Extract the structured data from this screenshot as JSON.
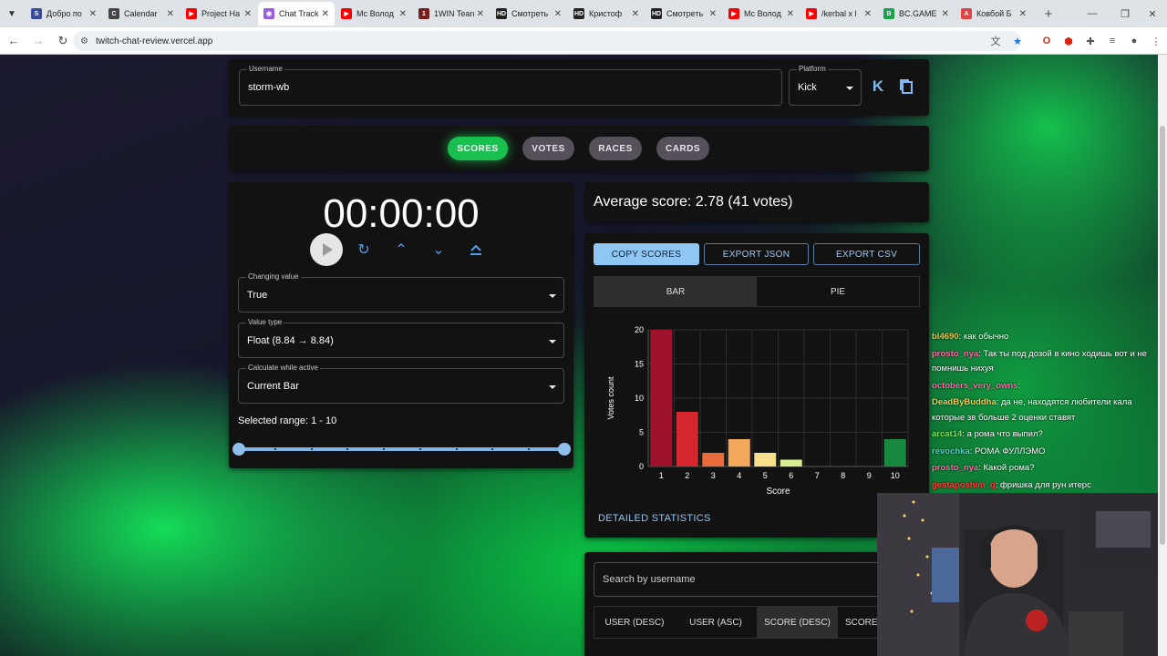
{
  "browser": {
    "tabs": [
      {
        "label": "Добро по",
        "color": "#3b4c9e",
        "glyph": "S"
      },
      {
        "label": "Calendar",
        "color": "#444444",
        "glyph": "C"
      },
      {
        "label": "Project Ha",
        "color": "#ff0000",
        "glyph": "▶"
      },
      {
        "label": "Chat Track",
        "color": "#9b5de5",
        "glyph": "◉",
        "active": true
      },
      {
        "label": "Мс Волод",
        "color": "#ff0000",
        "glyph": "▶"
      },
      {
        "label": "1WIN Tean",
        "color": "#7a1d1d",
        "glyph": "1"
      },
      {
        "label": "Смотреть",
        "color": "#222222",
        "glyph": "HD"
      },
      {
        "label": "Кристоф",
        "color": "#222222",
        "glyph": "HD"
      },
      {
        "label": "Смотреть",
        "color": "#222222",
        "glyph": "HD"
      },
      {
        "label": "Мс Волод",
        "color": "#ff0000",
        "glyph": "▶"
      },
      {
        "label": "/kerbal x l",
        "color": "#ff0000",
        "glyph": "▶"
      },
      {
        "label": "BC.GAME",
        "color": "#1aa34a",
        "glyph": "B"
      },
      {
        "label": "Ковбой Б",
        "color": "#e04444",
        "glyph": "A"
      }
    ],
    "url": "twitch-chat-review.vercel.app"
  },
  "settings": {
    "username_label": "Username",
    "username_value": "storm-wb",
    "platform_label": "Platform",
    "platform_value": "Kick"
  },
  "modes": [
    {
      "label": "SCORES",
      "active": true
    },
    {
      "label": "VOTES"
    },
    {
      "label": "RACES"
    },
    {
      "label": "CARDS"
    }
  ],
  "timer": {
    "display": "00:00:00",
    "changing_value_label": "Changing value",
    "changing_value": "True",
    "value_type_label": "Value type",
    "value_type": "Float (8.84 → 8.84)",
    "calc_label": "Calculate while active",
    "calc_value": "Current Bar",
    "range_text": "Selected range: 1 - 10",
    "range_min": 1,
    "range_max": 10
  },
  "summary": {
    "average_text": "Average score: 2.78 (41 votes)"
  },
  "actions": {
    "copy": "COPY SCORES",
    "export_json": "EXPORT JSON",
    "export_csv": "EXPORT CSV",
    "view_bar": "BAR",
    "view_pie": "PIE",
    "detailed": "DETAILED STATISTICS"
  },
  "chart_data": {
    "type": "bar",
    "categories": [
      "1",
      "2",
      "3",
      "4",
      "5",
      "6",
      "7",
      "8",
      "9",
      "10"
    ],
    "values": [
      20,
      8,
      2,
      4,
      2,
      1,
      0,
      0,
      0,
      4
    ],
    "colors": [
      "#a0122b",
      "#d6262e",
      "#ea6a3b",
      "#f2a85a",
      "#f7df8c",
      "#d7ee8f",
      "#a6d96a",
      "#66bd63",
      "#2e9a52",
      "#178a3f"
    ],
    "xlabel": "Score",
    "ylabel": "Votes count",
    "ylim": [
      0,
      20
    ],
    "yticks": [
      0,
      5,
      10,
      15,
      20
    ],
    "grid": true
  },
  "search": {
    "placeholder": "Search by username",
    "sorts": [
      "USER (DESC)",
      "USER (ASC)",
      "SCORE (DESC)",
      "SCORE"
    ]
  },
  "chat": [
    {
      "user": "bl4690",
      "color": "#e8c547",
      "text": "как обычно"
    },
    {
      "user": "prosto_nya",
      "color": "#ff6aa8",
      "text": "Так ты под дозой в кино ходишь вот и не помнишь нихуя"
    },
    {
      "user": "octobers_very_owns",
      "color": "#ff6aa8",
      "text": ""
    },
    {
      "user": "DeadByBuddha",
      "color": "#f0d04a",
      "text": "да не, находятся любители кала которые зв больше 2 оценки ставят"
    },
    {
      "user": "arcat14",
      "color": "#7be35a",
      "text": "а рома что выпил?"
    },
    {
      "user": "revochka",
      "color": "#4fd1c5",
      "text": "РОМА ФУЛЛЭМО"
    },
    {
      "user": "prosto_nya",
      "color": "#ff6aa8",
      "text": "Какой рома?"
    },
    {
      "user": "gestaposhim_q",
      "color": "#ff3b3b",
      "text": "фришка для рун итерс"
    }
  ]
}
